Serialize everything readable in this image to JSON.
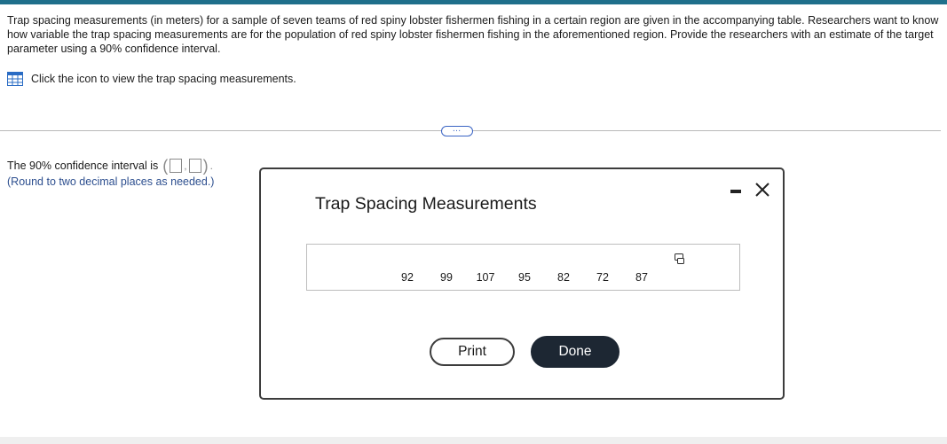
{
  "question": {
    "text": "Trap spacing measurements (in meters) for a sample of seven teams of red spiny lobster fishermen fishing in a certain region are given in the accompanying table. Researchers want to know how variable the trap spacing measurements are for the population of red spiny lobster fishermen fishing in the aforementioned region. Provide the researchers with an estimate of the target parameter using a 90% confidence interval."
  },
  "view_link": {
    "icon": "table-grid-icon",
    "label": "Click the icon to view the trap spacing measurements."
  },
  "expand": {
    "label": "…"
  },
  "answer": {
    "prefix": "The 90% confidence interval is",
    "open_paren": "(",
    "separator": ",",
    "close_paren": ")",
    "suffix": ".",
    "lower_value": "",
    "upper_value": "",
    "note": "(Round to two decimal places as needed.)"
  },
  "dialog": {
    "title": "Trap Spacing Measurements",
    "minimize_icon": "minimize-icon",
    "close_icon": "close-icon",
    "copy_icon": "copy-icon",
    "measurements": [
      "92",
      "99",
      "107",
      "95",
      "82",
      "72",
      "87"
    ],
    "print_label": "Print",
    "done_label": "Done"
  },
  "colors": {
    "top_bar": "#1f6f8b",
    "link_icon": "#2a6cc4",
    "note_text": "#2d4f8f",
    "done_button": "#1d2733"
  }
}
